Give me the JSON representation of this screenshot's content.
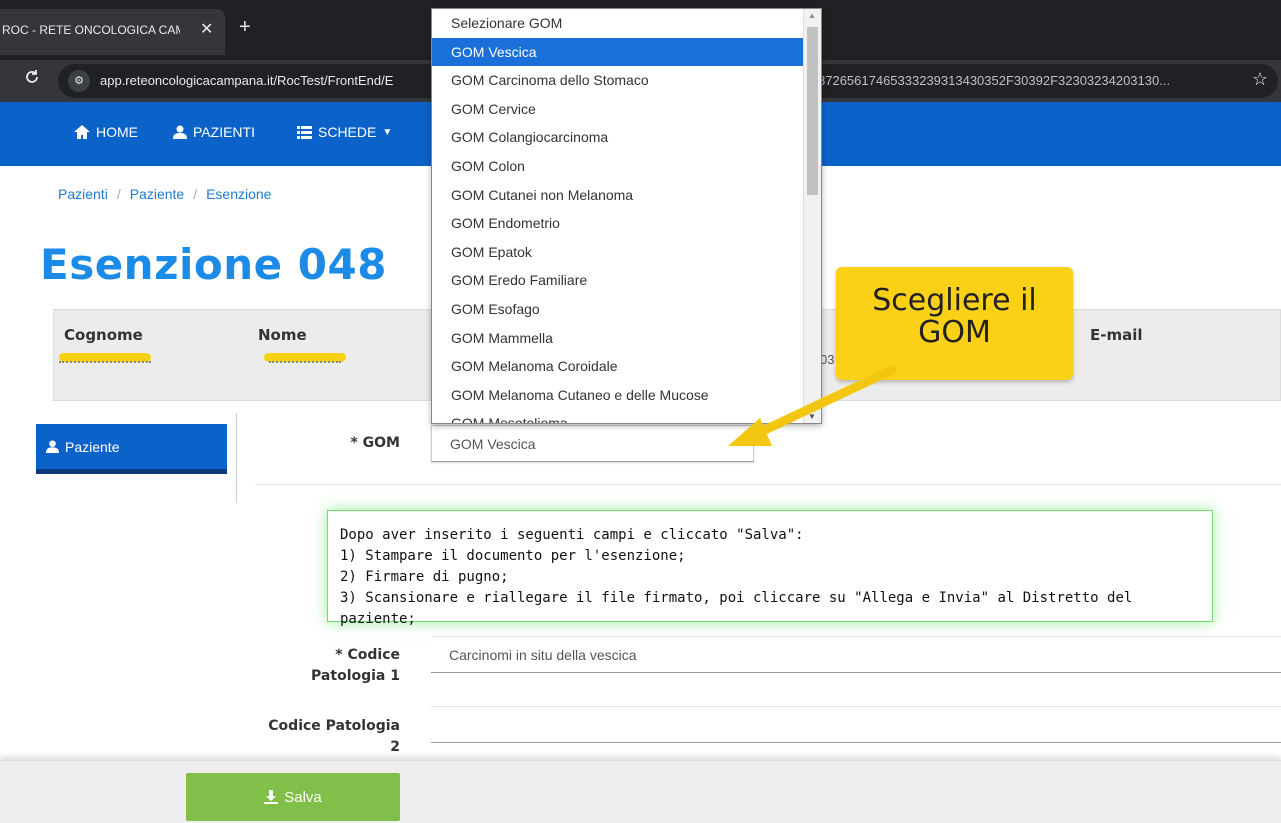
{
  "browser": {
    "tab_title": "ROC - RETE ONCOLOGICA CAM",
    "close": "✕",
    "new_tab": "+",
    "url_left": "app.reteoncologicacampana.it/RocTest/FrontEnd/E",
    "url_right": "87265617465333239313430352F30392F32303234203130...",
    "reload": "C"
  },
  "nav": {
    "home": "HOME",
    "patients": "PAZIENTI",
    "forms": "SCHEDE"
  },
  "breadcrumb": [
    "Pazienti",
    "Paziente",
    "Esenzione"
  ],
  "page_title": "Esenzione 048",
  "patient": {
    "surname_header": "Cognome",
    "name_header": "Nome",
    "email_header": "E-mail",
    "partial_value": "03"
  },
  "side_tab": "Paziente",
  "gom": {
    "label": "* GOM",
    "value": "GOM Vescica",
    "options": [
      "Selezionare GOM",
      "GOM Vescica",
      "GOM Carcinoma dello Stomaco",
      "GOM Cervice",
      "GOM Colangiocarcinoma",
      "GOM Colon",
      "GOM Cutanei non Melanoma",
      "GOM Endometrio",
      "GOM Epatok",
      "GOM Eredo Familiare",
      "GOM Esofago",
      "GOM Mammella",
      "GOM Melanoma Coroidale",
      "GOM Melanoma Cutaneo e delle Mucose",
      "GOM Mesotelioma"
    ]
  },
  "info": [
    "Dopo aver inserito i seguenti campi e cliccato \"Salva\":",
    "1) Stampare il documento per l'esenzione;",
    "2) Firmare di pugno;",
    "3) Scansionare e riallegare il file firmato, poi cliccare su \"Allega e Invia\" al Distretto del paziente;"
  ],
  "code1": {
    "label_line1": "* Codice",
    "label_line2": "Patologia 1",
    "value": "Carcinomi in situ della vescica"
  },
  "code2": {
    "label_line1": "Codice Patologia",
    "label_line2": "2",
    "value": ""
  },
  "save_label": "Salva",
  "callout": {
    "line1": "Scegliere il",
    "line2": "GOM"
  },
  "colors": {
    "brand_blue": "#0b63c9",
    "title_blue": "#1c8be8",
    "save_green": "#7fbf4a",
    "callout_yellow": "#fbd117"
  }
}
